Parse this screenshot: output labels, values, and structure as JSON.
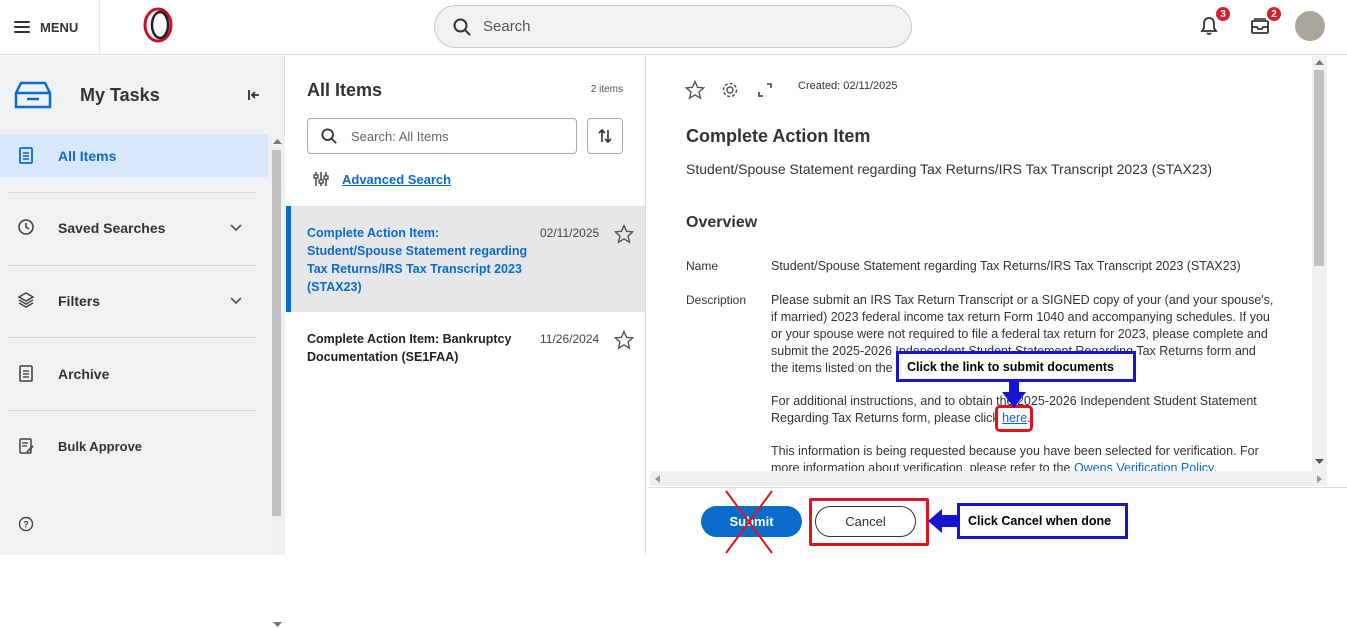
{
  "header": {
    "menu_label": "MENU",
    "search_placeholder": "Search",
    "notifications_count": "3",
    "inbox_count": "2"
  },
  "sidebar": {
    "title": "My Tasks",
    "items": [
      {
        "label": "All Items"
      },
      {
        "label": "Saved Searches"
      },
      {
        "label": "Filters"
      },
      {
        "label": "Archive"
      },
      {
        "label": "Bulk Approve"
      }
    ]
  },
  "list": {
    "title": "All Items",
    "count": "2 items",
    "search_placeholder": "Search: All Items",
    "advanced_search": "Advanced Search",
    "items": [
      {
        "title": "Complete Action Item: Student/Spouse Statement regarding Tax Returns/IRS Tax Transcript 2023 (STAX23)",
        "date": "02/11/2025"
      },
      {
        "title": "Complete Action Item: Bankruptcy Documentation (SE1FAA)",
        "date": "11/26/2024"
      }
    ]
  },
  "detail": {
    "created": "Created: 02/11/2025",
    "heading": "Complete Action Item",
    "subheading": "Student/Spouse Statement regarding Tax Returns/IRS Tax Transcript 2023 (STAX23)",
    "overview_heading": "Overview",
    "name_label": "Name",
    "name_value": "Student/Spouse Statement regarding Tax Returns/IRS Tax Transcript 2023 (STAX23)",
    "description_label": "Description",
    "desc_p1": "Please submit an IRS Tax Return Transcript or a SIGNED copy of your (and your spouse's, if married) 2023 federal income tax return Form 1040 and accompanying schedules.  If you or your spouse were not required to file a federal tax return for 2023, please complete and submit the 2025-2026 Independent Student Statement Regarding Tax Returns form and the items listed on the form.",
    "desc_p2_before": "For additional instructions, and to obtain the 2025-2026 Independent Student Statement Regarding Tax Returns form, please click ",
    "desc_p2_link": "here",
    "desc_p2_after": ".",
    "desc_p3_before": "This information is being requested because you have been selected for verification.  For more information about verification, please refer to the ",
    "desc_p3_link": "Owens Verification Policy",
    "desc_p3_after": "."
  },
  "footer": {
    "submit_label": "Submit",
    "cancel_label": "Cancel"
  },
  "annotations": {
    "link_callout": "Click the link to submit documents",
    "cancel_callout": "Click Cancel when done",
    "arrow_color": "#1414d2",
    "highlight_color": "#e0141e"
  }
}
